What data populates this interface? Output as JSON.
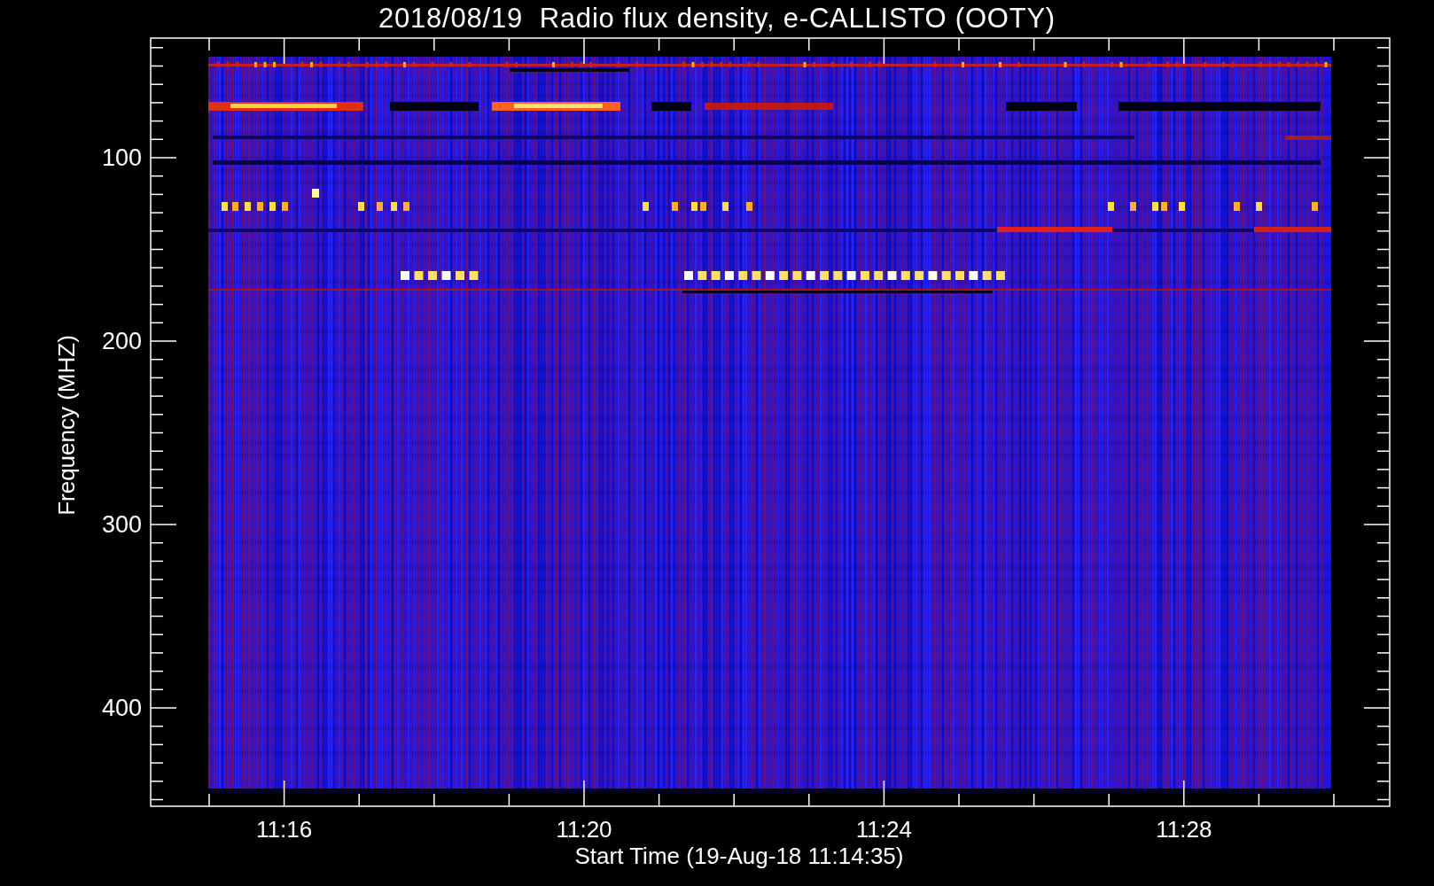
{
  "title": "2018/08/19  Radio flux density, e-CALLISTO (OOTY)",
  "y_axis": {
    "label": "Frequency (MHZ)",
    "ticks": [
      "100",
      "200",
      "300",
      "400"
    ]
  },
  "x_axis": {
    "label": "Start Time (19-Aug-18 11:14:35)",
    "ticks": [
      "11:16",
      "11:20",
      "11:24",
      "11:28"
    ]
  }
}
